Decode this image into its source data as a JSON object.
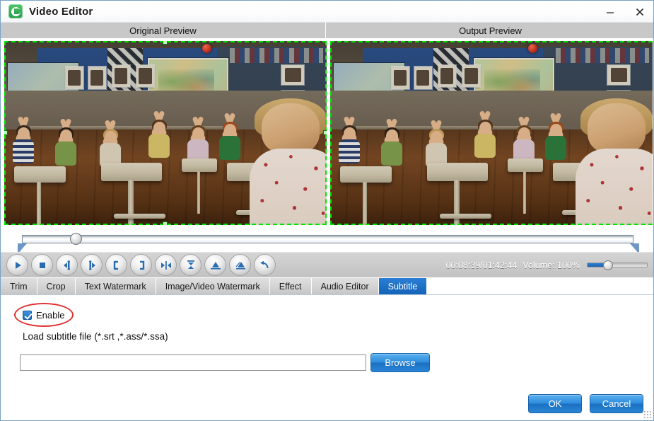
{
  "window": {
    "title": "Video Editor",
    "app_icon": "app-logo-icon",
    "minimize_label": "Minimize",
    "close_label": "Close"
  },
  "previews": {
    "original_label": "Original Preview",
    "output_label": "Output Preview"
  },
  "timeline": {
    "position_percent": 8,
    "trim_start_label": "trim-start-marker",
    "trim_end_label": "trim-end-marker"
  },
  "player": {
    "buttons": [
      {
        "name": "play-button",
        "icon": "play-icon"
      },
      {
        "name": "stop-button",
        "icon": "stop-icon"
      },
      {
        "name": "previous-frame-button",
        "icon": "previous-frame-icon"
      },
      {
        "name": "next-frame-button",
        "icon": "next-frame-icon"
      },
      {
        "name": "set-start-point-button",
        "icon": "bracket-left-icon"
      },
      {
        "name": "set-end-point-button",
        "icon": "bracket-right-icon"
      },
      {
        "name": "split-button",
        "icon": "split-icon"
      },
      {
        "name": "merge-button",
        "icon": "merge-icon"
      },
      {
        "name": "snapshot-button",
        "icon": "snapshot-icon"
      },
      {
        "name": "capture-button",
        "icon": "capture-icon"
      },
      {
        "name": "undo-button",
        "icon": "undo-arrow-icon"
      }
    ],
    "time_text": "00:08:39/01:42:44",
    "volume_label": "Volume:  100%",
    "volume_percent": 100
  },
  "tabs": [
    {
      "label": "Trim",
      "active": false
    },
    {
      "label": "Crop",
      "active": false
    },
    {
      "label": "Text Watermark",
      "active": false
    },
    {
      "label": "Image/Video Watermark",
      "active": false
    },
    {
      "label": "Effect",
      "active": false
    },
    {
      "label": "Audio Editor",
      "active": false
    },
    {
      "label": "Subtitle",
      "active": true
    }
  ],
  "subtitle_panel": {
    "enable_label": "Enable",
    "enable_checked": true,
    "load_label": "Load subtitle file (*.srt ,*.ass/*.ssa)",
    "file_path_value": "",
    "file_path_placeholder": "",
    "browse_label": "Browse"
  },
  "footer": {
    "ok_label": "OK",
    "cancel_label": "Cancel"
  },
  "colors": {
    "accent_blue": "#1464b8",
    "tab_active_bg": "#1464b8",
    "annotation_red": "#e03131",
    "crop_border_green": "#00e500"
  }
}
